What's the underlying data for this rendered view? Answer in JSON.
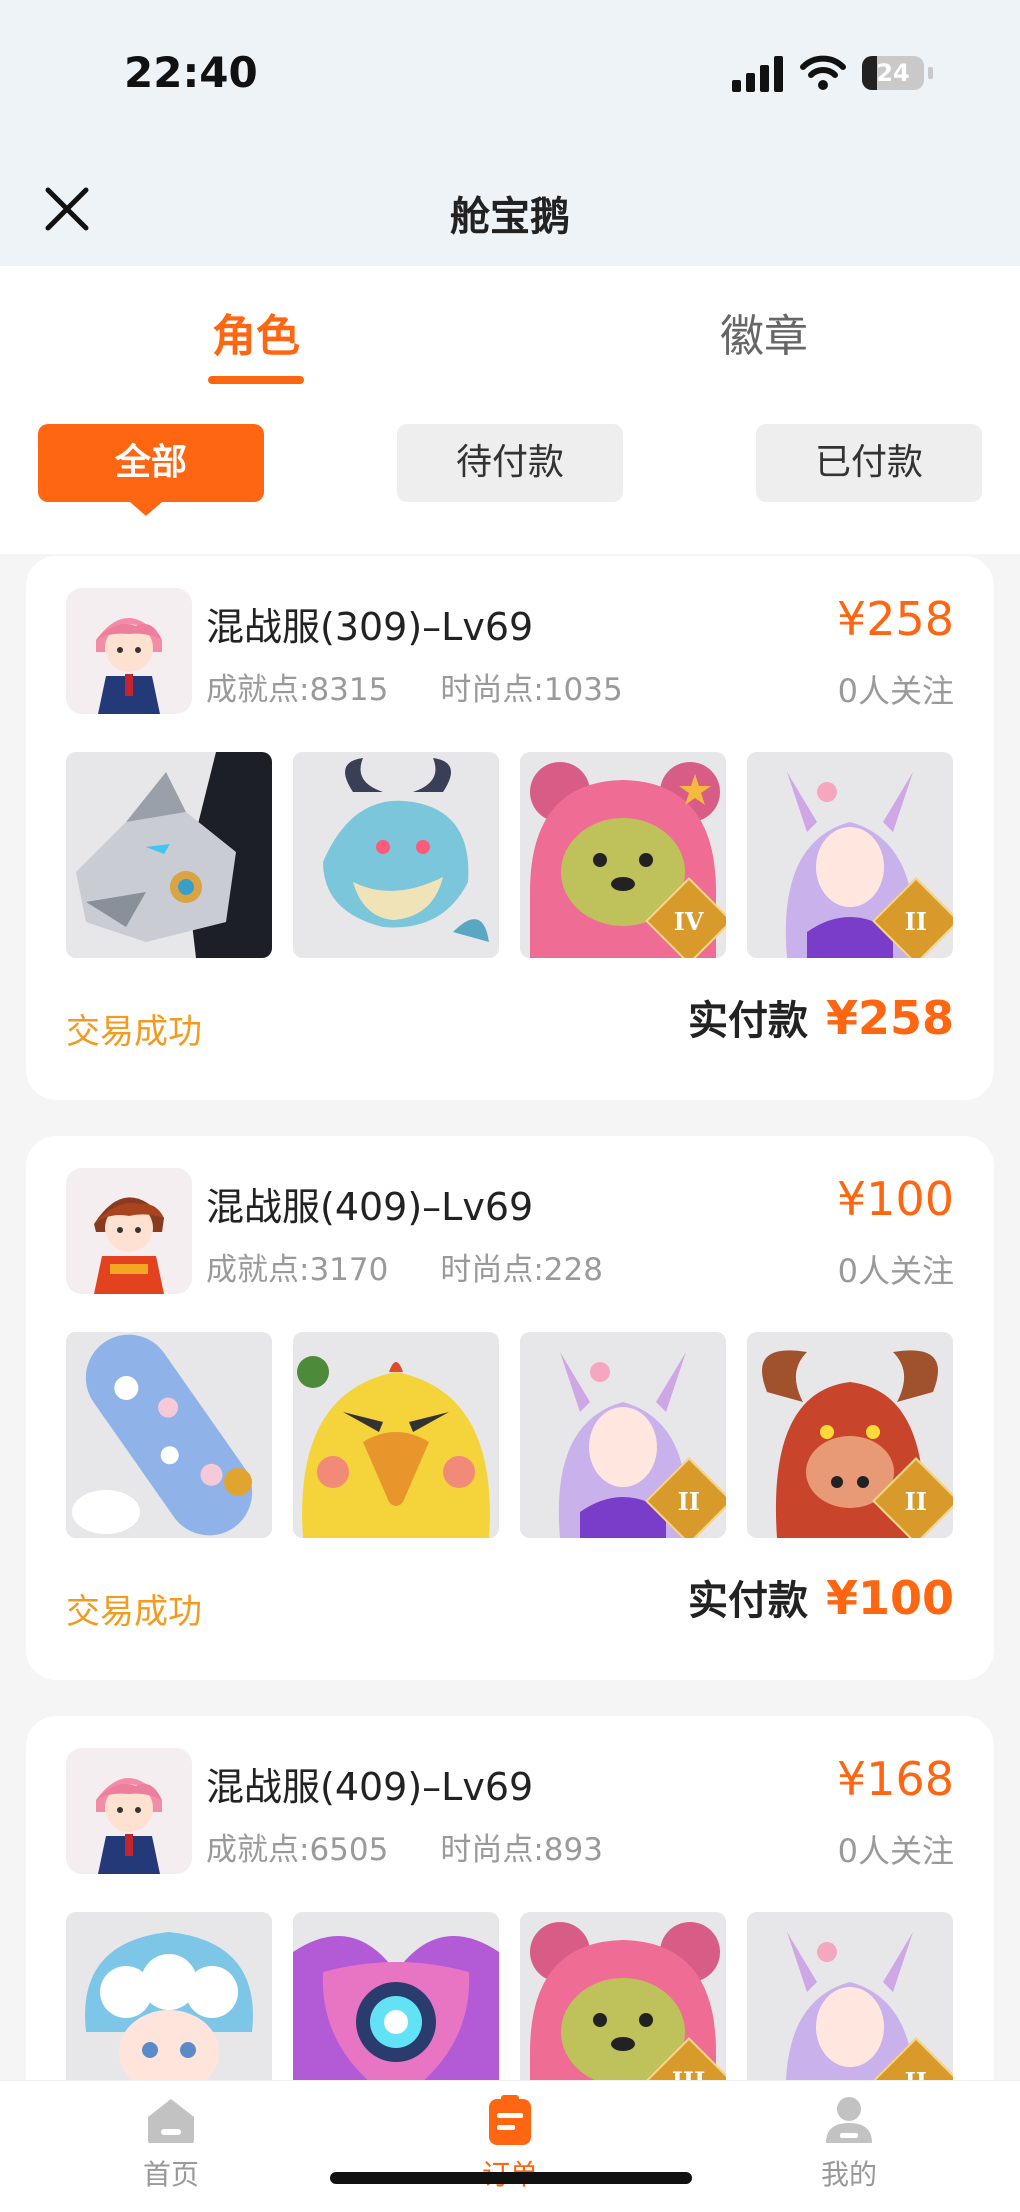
{
  "status_bar": {
    "time": "22:40",
    "battery": "24",
    "battery_level": 0.24
  },
  "header": {
    "title": "舱宝鹅"
  },
  "tabs": [
    {
      "label": "角色",
      "active": true
    },
    {
      "label": "徽章",
      "active": false
    }
  ],
  "filters": [
    {
      "label": "全部",
      "active": true
    },
    {
      "label": "待付款",
      "active": false
    },
    {
      "label": "已付款",
      "active": false
    }
  ],
  "orders": [
    {
      "server": "混战服(309)–Lv69",
      "achievement": "成就点:8315",
      "fashion": "时尚点:1035",
      "price": "¥258",
      "followers": "0人关注",
      "status": "交易成功",
      "paid_label": "实付款",
      "paid_amount": "¥258",
      "items": [
        {
          "icon": "silver-mecha-dragon-mount",
          "badge": ""
        },
        {
          "icon": "blue-dragon-pet",
          "badge": ""
        },
        {
          "icon": "pink-bear-hood-pet",
          "badge": "IV"
        },
        {
          "icon": "fox-spirit-costume",
          "badge": "II"
        }
      ]
    },
    {
      "server": "混战服(409)–Lv69",
      "achievement": "成就点:3170",
      "fashion": "时尚点:228",
      "price": "¥100",
      "followers": "0人关注",
      "status": "交易成功",
      "paid_label": "实付款",
      "paid_amount": "¥100",
      "items": [
        {
          "icon": "sakura-skateboard",
          "badge": ""
        },
        {
          "icon": "yellow-chick-pet",
          "badge": ""
        },
        {
          "icon": "fox-spirit-costume",
          "badge": "II"
        },
        {
          "icon": "red-bull-demon",
          "badge": "II"
        }
      ]
    },
    {
      "server": "混战服(409)–Lv69",
      "achievement": "成就点:6505",
      "fashion": "时尚点:893",
      "price": "¥168",
      "followers": "0人关注",
      "status": "",
      "paid_label": "",
      "paid_amount": "",
      "items": [
        {
          "icon": "sheep-girl-hat",
          "badge": ""
        },
        {
          "icon": "heart-orb-wings",
          "badge": ""
        },
        {
          "icon": "pink-bear-hood-pet",
          "badge": "III"
        },
        {
          "icon": "fox-spirit-costume",
          "badge": "II"
        }
      ]
    }
  ],
  "bottom_nav": [
    {
      "label": "首页",
      "icon": "home-icon",
      "active": false
    },
    {
      "label": "订单",
      "icon": "order-icon",
      "active": true
    },
    {
      "label": "我的",
      "icon": "profile-icon",
      "active": false
    }
  ],
  "colors": {
    "accent": "#ff6611",
    "status_success": "#f39a1f",
    "muted": "#9a9a9a"
  }
}
